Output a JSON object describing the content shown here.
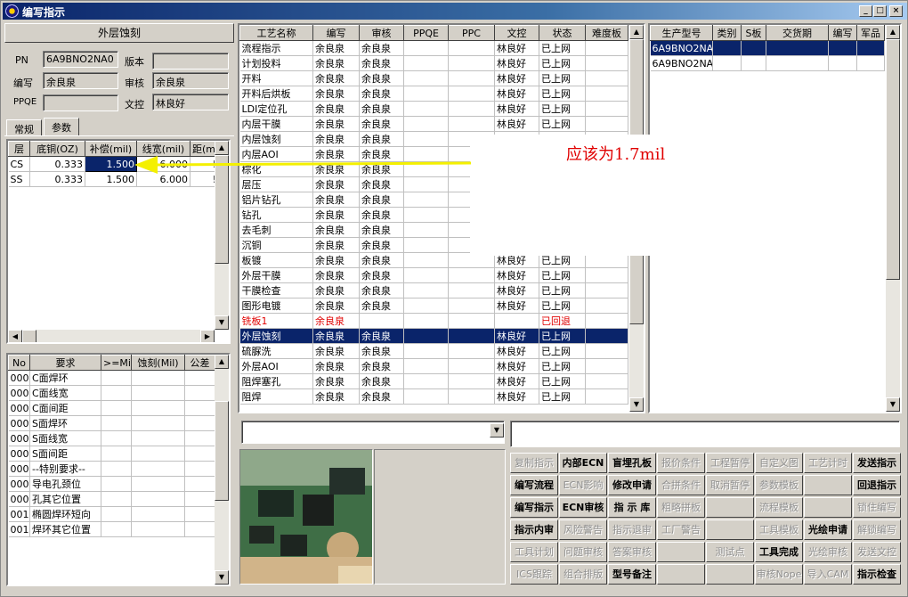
{
  "window": {
    "title": "编写指示",
    "min_icon": "_",
    "max_icon": "□",
    "close_icon": "×"
  },
  "left": {
    "header": "外层蚀刻",
    "fields": {
      "pn_label": "PN",
      "pn_value": "6A9BNO2NA0",
      "version_label": "版本",
      "version_value": "",
      "writer_label": "编写",
      "writer_value": "余良泉",
      "reviewer_label": "审核",
      "reviewer_value": "余良泉",
      "ppqe_label": "PPQE",
      "ppqe_value": "",
      "doc_label": "文控",
      "doc_value": "林良好"
    },
    "tabs": [
      "常规",
      "参数"
    ],
    "param_table": {
      "headers": [
        "层",
        "底铜(OZ)",
        "补偿(mil)",
        "线宽(mil)",
        "距(mi"
      ],
      "rows": [
        [
          "CS",
          "0.333",
          "1.500",
          "6.000",
          "!"
        ],
        [
          "SS",
          "0.333",
          "1.500",
          "6.000",
          "!"
        ]
      ]
    },
    "req_table": {
      "headers": [
        "No",
        "要求",
        ">=Mil",
        "蚀刻(Mil)",
        "公差"
      ],
      "rows": [
        [
          "000",
          "C面焊环"
        ],
        [
          "000",
          "C面线宽"
        ],
        [
          "000",
          "C面间距"
        ],
        [
          "000",
          "S面焊环"
        ],
        [
          "000",
          "S面线宽"
        ],
        [
          "000",
          "S面间距"
        ],
        [
          "000",
          "--特别要求--"
        ],
        [
          "000",
          "导电孔颈位"
        ],
        [
          "000",
          "孔其它位置"
        ],
        [
          "001",
          "椭圆焊环短向"
        ],
        [
          "001",
          "焊环其它位置"
        ]
      ]
    }
  },
  "process": {
    "headers": [
      "工艺名称",
      "编写",
      "审核",
      "PPQE",
      "PPC",
      "文控",
      "状态",
      "难度板"
    ],
    "rows": [
      [
        "流程指示",
        "余良泉",
        "余良泉",
        "",
        "",
        "林良好",
        "已上网",
        ""
      ],
      [
        "计划投料",
        "余良泉",
        "余良泉",
        "",
        "",
        "林良好",
        "已上网",
        ""
      ],
      [
        "开料",
        "余良泉",
        "余良泉",
        "",
        "",
        "林良好",
        "已上网",
        ""
      ],
      [
        "开料后烘板",
        "余良泉",
        "余良泉",
        "",
        "",
        "林良好",
        "已上网",
        ""
      ],
      [
        "LDI定位孔",
        "余良泉",
        "余良泉",
        "",
        "",
        "林良好",
        "已上网",
        ""
      ],
      [
        "内层干膜",
        "余良泉",
        "余良泉",
        "",
        "",
        "林良好",
        "已上网",
        ""
      ],
      [
        "内层蚀刻",
        "余良泉",
        "余良泉",
        "",
        "",
        "",
        "",
        ""
      ],
      [
        "内层AOI",
        "余良泉",
        "余良泉",
        "",
        "",
        "",
        "",
        ""
      ],
      [
        "棕化",
        "余良泉",
        "余良泉",
        "",
        "",
        "",
        "",
        ""
      ],
      [
        "层压",
        "余良泉",
        "余良泉",
        "",
        "",
        "",
        "",
        ""
      ],
      [
        "铝片钻孔",
        "余良泉",
        "余良泉",
        "",
        "",
        "",
        "",
        ""
      ],
      [
        "钻孔",
        "余良泉",
        "余良泉",
        "",
        "",
        "",
        "",
        ""
      ],
      [
        "去毛刺",
        "余良泉",
        "余良泉",
        "",
        "",
        "",
        "",
        ""
      ],
      [
        "沉铜",
        "余良泉",
        "余良泉",
        "",
        "",
        "",
        "",
        ""
      ],
      [
        "板镀",
        "余良泉",
        "余良泉",
        "",
        "",
        "林良好",
        "已上网",
        ""
      ],
      [
        "外层干膜",
        "余良泉",
        "余良泉",
        "",
        "",
        "林良好",
        "已上网",
        ""
      ],
      [
        "干膜检查",
        "余良泉",
        "余良泉",
        "",
        "",
        "林良好",
        "已上网",
        ""
      ],
      [
        "图形电镀",
        "余良泉",
        "余良泉",
        "",
        "",
        "林良好",
        "已上网",
        ""
      ],
      [
        "铣板1",
        "余良泉",
        "",
        "",
        "",
        "",
        "已回退",
        ""
      ],
      [
        "外层蚀刻",
        "余良泉",
        "余良泉",
        "",
        "",
        "林良好",
        "已上网",
        ""
      ],
      [
        "硫脲洗",
        "余良泉",
        "余良泉",
        "",
        "",
        "林良好",
        "已上网",
        ""
      ],
      [
        "外层AOI",
        "余良泉",
        "余良泉",
        "",
        "",
        "林良好",
        "已上网",
        ""
      ],
      [
        "阻焊塞孔",
        "余良泉",
        "余良泉",
        "",
        "",
        "林良好",
        "已上网",
        ""
      ],
      [
        "阻焊",
        "余良泉",
        "余良泉",
        "",
        "",
        "林良好",
        "已上网",
        ""
      ]
    ]
  },
  "products": {
    "headers": [
      "生产型号",
      "类别",
      "S板",
      "交货期",
      "编写",
      "军品"
    ],
    "rows": [
      [
        "6A9BNO2NA0",
        "",
        "",
        "",
        "",
        ""
      ],
      [
        "6A9BNO2NA0",
        "",
        "",
        "",
        "",
        ""
      ]
    ]
  },
  "annotation": {
    "text": "应该为1.7mil"
  },
  "buttons": [
    [
      "复制指示",
      "内部ECN",
      "盲埋孔板",
      "报价条件",
      "工程暂停",
      "自定义图",
      "工艺计时",
      "发送指示"
    ],
    [
      "编写流程",
      "ECN影响",
      "修改申请",
      "合拼条件",
      "取消暂停",
      "参数模板",
      "",
      "回退指示"
    ],
    [
      "编写指示",
      "ECN审核",
      "指 示 库",
      "粗略拼板",
      "",
      "流程模板",
      "",
      "锁住编写"
    ],
    [
      "指示内审",
      "风险警告",
      "指示退审",
      "工厂警告",
      "",
      "工具模板",
      "光绘申请",
      "解锁编写"
    ],
    [
      "工具计划",
      "问题审核",
      "答案审核",
      "",
      "测试点",
      "工具完成",
      "光绘审核",
      "发送文控"
    ],
    [
      "ICS跟踪",
      "组合排版",
      "型号备注",
      "",
      "",
      "审核Nope",
      "导入CAM",
      "指示检查"
    ]
  ],
  "enabled": [
    [
      false,
      true,
      true,
      false,
      false,
      false,
      false,
      true
    ],
    [
      true,
      false,
      true,
      false,
      false,
      false,
      false,
      true
    ],
    [
      true,
      true,
      true,
      false,
      false,
      false,
      false,
      false
    ],
    [
      true,
      false,
      false,
      false,
      false,
      false,
      true,
      false
    ],
    [
      false,
      false,
      false,
      false,
      false,
      true,
      false,
      false
    ],
    [
      false,
      false,
      true,
      false,
      false,
      false,
      false,
      true
    ]
  ]
}
